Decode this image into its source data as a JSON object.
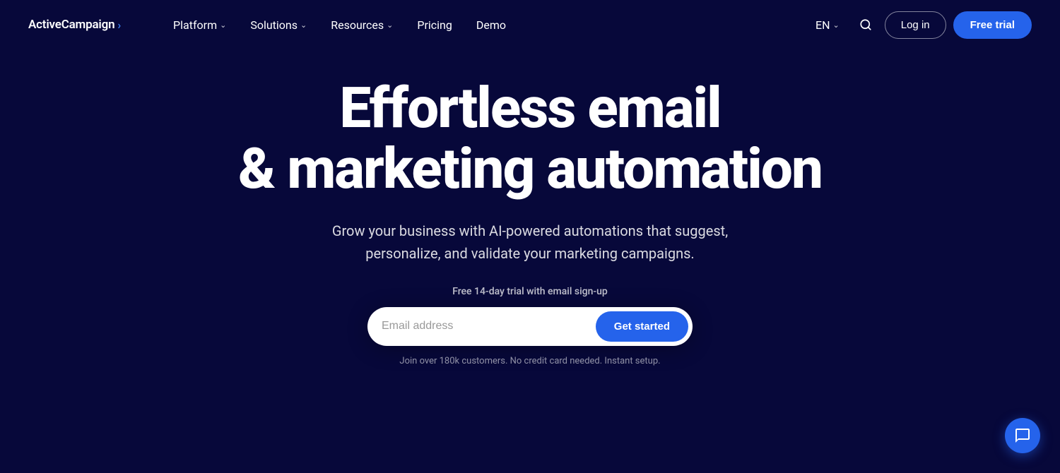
{
  "brand": {
    "name": "ActiveCampaign",
    "arrow": "›"
  },
  "nav": {
    "links": [
      {
        "label": "Platform",
        "has_dropdown": true
      },
      {
        "label": "Solutions",
        "has_dropdown": true
      },
      {
        "label": "Resources",
        "has_dropdown": true
      },
      {
        "label": "Pricing",
        "has_dropdown": false
      },
      {
        "label": "Demo",
        "has_dropdown": false
      }
    ],
    "lang": "EN",
    "login_label": "Log in",
    "trial_label": "Free trial"
  },
  "hero": {
    "title_line1": "Effortless email",
    "title_line2": "& marketing automation",
    "subtitle": "Grow your business with AI-powered automations that suggest, personalize, and validate your marketing campaigns.",
    "trial_text": "Free 14-day trial with email sign-up",
    "email_placeholder": "Email address",
    "cta_label": "Get started",
    "social_proof": "Join over 180k customers. No credit card needed. Instant setup."
  }
}
